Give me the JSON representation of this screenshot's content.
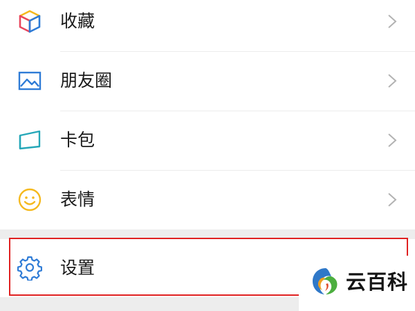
{
  "menu": {
    "items": [
      {
        "label": "收藏",
        "icon": "favorites-cube-icon"
      },
      {
        "label": "朋友圈",
        "icon": "moments-image-icon"
      },
      {
        "label": "卡包",
        "icon": "card-wallet-icon"
      },
      {
        "label": "表情",
        "icon": "smiley-icon"
      }
    ],
    "settings": {
      "label": "设置",
      "icon": "gear-icon"
    }
  },
  "watermark": {
    "text": "云百科",
    "icon": "yunbaike-logo"
  },
  "colors": {
    "highlight": "#e02020",
    "icon_blue": "#2e7bd6",
    "smiley_yellow": "#f5b91e",
    "chevron": "#b2b2b2"
  }
}
